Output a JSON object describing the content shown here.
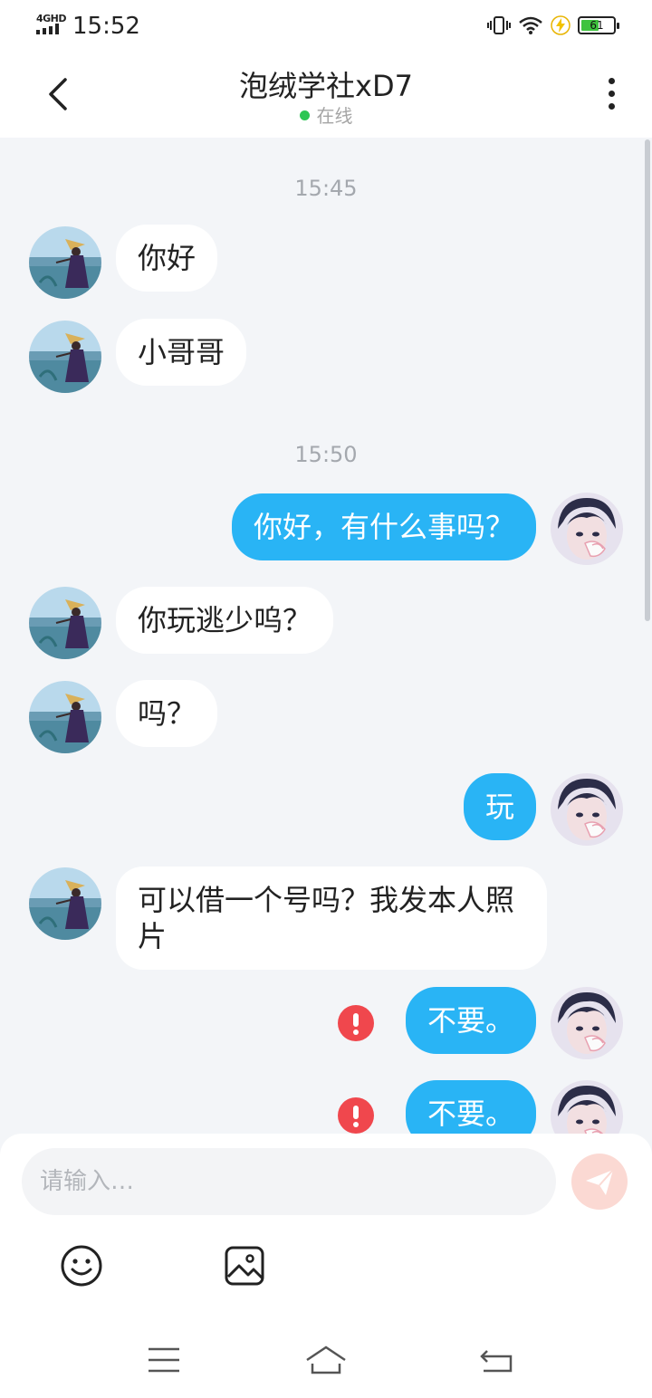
{
  "status_bar": {
    "network": "4GHD",
    "time": "15:52",
    "battery": "61",
    "battery_level": 0.61
  },
  "header": {
    "title": "泡绒学社xD7",
    "status": "在线"
  },
  "chat": {
    "timestamps": [
      "15:45",
      "15:50"
    ],
    "messages": [
      {
        "from": "them",
        "text": "你好"
      },
      {
        "from": "them",
        "text": "小哥哥"
      },
      {
        "from": "me",
        "text": "你好，有什么事吗？"
      },
      {
        "from": "them",
        "text": "你玩逃少呜？"
      },
      {
        "from": "them",
        "text": "吗？"
      },
      {
        "from": "me",
        "text": "玩"
      },
      {
        "from": "them",
        "text": "可以借一个号吗？我发本人照片"
      },
      {
        "from": "me",
        "text": "不要。",
        "failed": true
      },
      {
        "from": "me",
        "text": "不要。",
        "failed": true
      }
    ]
  },
  "composer": {
    "placeholder": "请输入…"
  },
  "colors": {
    "outgoing_bubble": "#29b4f5",
    "incoming_bubble": "#ffffff",
    "online_dot": "#2dc653",
    "error_badge": "#f0474d",
    "send_button": "#fbd9d3"
  },
  "icons": {
    "back": "chevron-left-icon",
    "more": "more-vertical-icon",
    "send": "paper-plane-icon",
    "emoji": "smiley-icon",
    "image": "image-icon",
    "error": "exclamation-icon"
  }
}
